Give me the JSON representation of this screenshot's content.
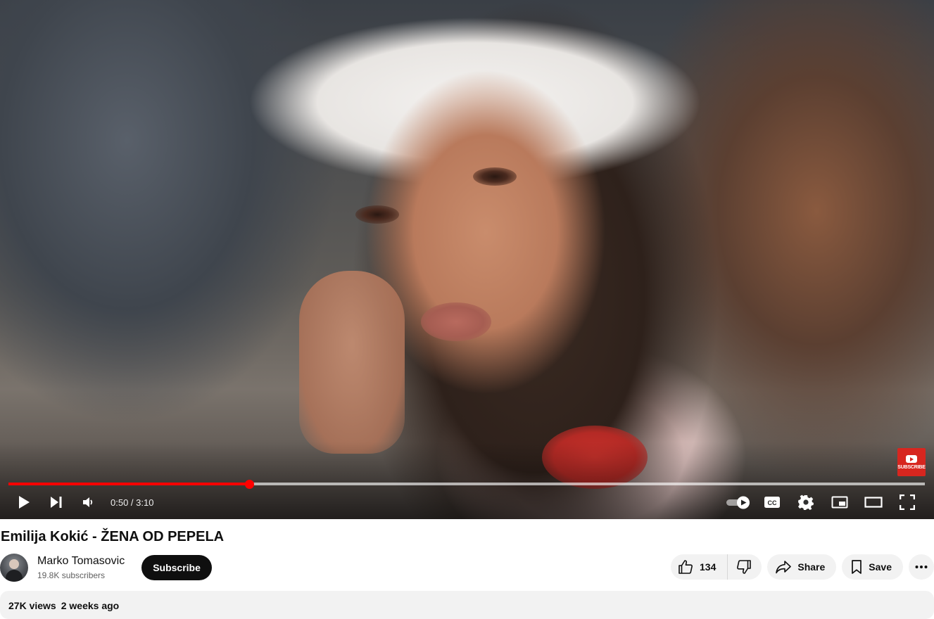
{
  "player": {
    "current_time": "0:50",
    "duration": "3:10",
    "time_separator": " / ",
    "progress_fraction": 0.263,
    "loaded_fraction": 1.0,
    "watermark_text": "SUBSCRIBE",
    "accent_color": "#ff0000"
  },
  "video": {
    "title": "Emilija Kokić - ŽENA OD PEPELA"
  },
  "channel": {
    "name": "Marko Tomasovic",
    "subscribers": "19.8K subscribers",
    "subscribe_label": "Subscribe"
  },
  "actions": {
    "like_count": "134",
    "share_label": "Share",
    "save_label": "Save"
  },
  "description": {
    "views": "27K views",
    "date": "2 weeks ago"
  },
  "icons": {
    "play": "play-icon",
    "next": "next-icon",
    "volume": "volume-icon",
    "autoplay": "autoplay-toggle-icon",
    "captions": "captions-icon",
    "settings": "gear-icon",
    "miniplayer": "miniplayer-icon",
    "theater": "theater-mode-icon",
    "fullscreen": "fullscreen-icon",
    "like": "thumbs-up-icon",
    "dislike": "thumbs-down-icon",
    "share": "share-arrow-icon",
    "save": "bookmark-icon",
    "more": "more-dots-icon"
  }
}
